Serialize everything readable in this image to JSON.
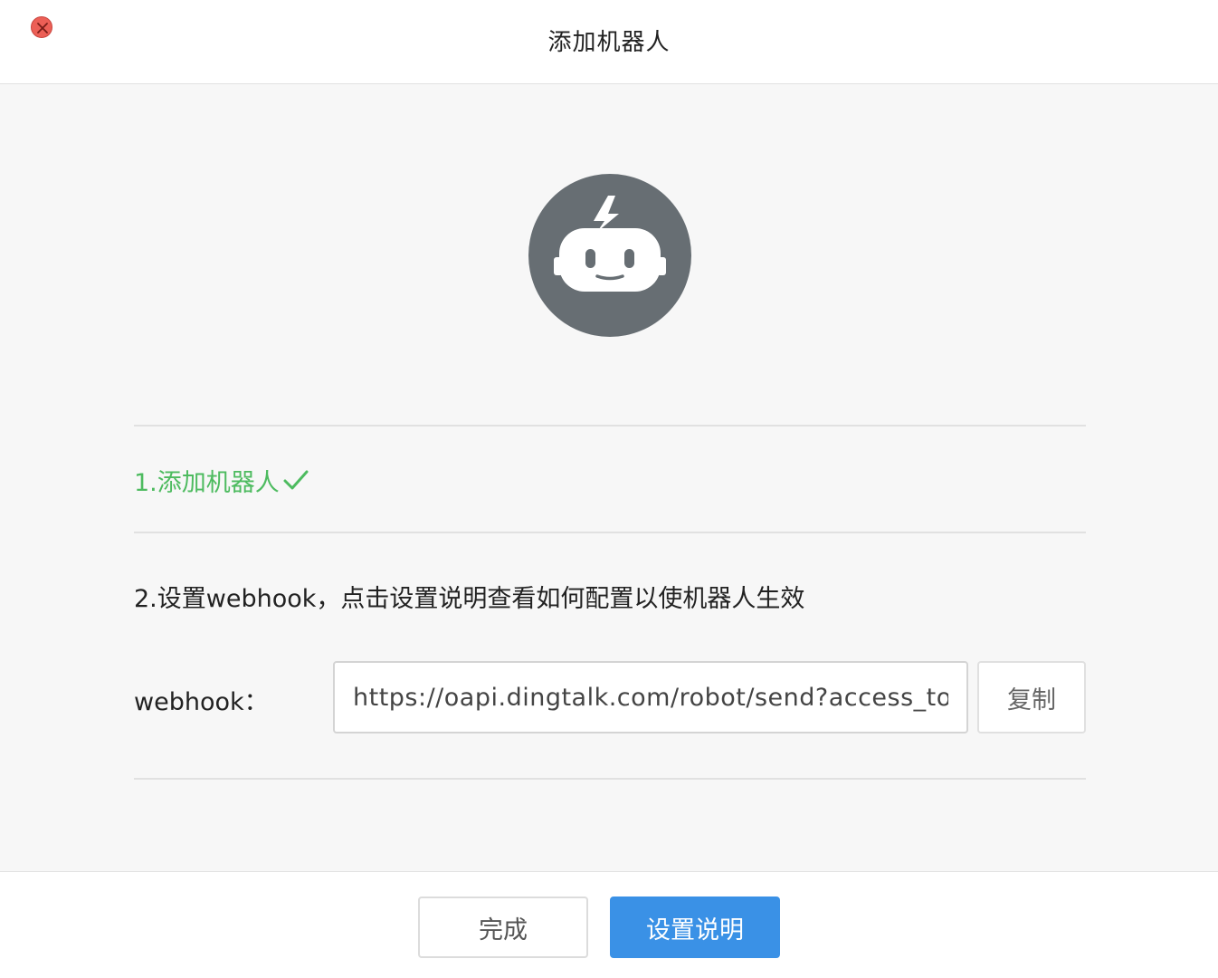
{
  "window": {
    "title": "添加机器人",
    "close_icon": "close-icon"
  },
  "robot": {
    "icon": "robot-icon",
    "bg_color": "#676e73"
  },
  "step1": {
    "label": "1.添加机器人",
    "status_icon": "checkmark-icon",
    "color": "#4dbb5f"
  },
  "step2": {
    "label": "2.设置webhook，点击设置说明查看如何配置以使机器人生效"
  },
  "webhook": {
    "label": "webhook：",
    "value": "https://oapi.dingtalk.com/robot/send?access_token",
    "copy_label": "复制"
  },
  "footer": {
    "done_label": "完成",
    "guide_label": "设置说明",
    "accent": "#3a91e6"
  }
}
